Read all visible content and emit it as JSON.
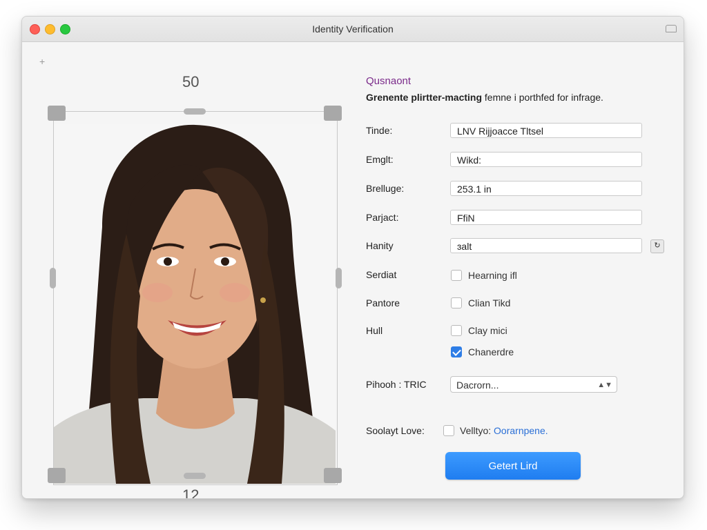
{
  "window": {
    "title": "Identity Verification"
  },
  "crop": {
    "top_value": "50",
    "bottom_value": "12",
    "add_icon": "+"
  },
  "form": {
    "heading": "Qusnaont",
    "subtitle_bold": "Grenente plirtter-macting",
    "subtitle_rest": " femne i porthfed for infrage.",
    "fields": [
      {
        "label": "Tinde:",
        "value": "LNV Rijjoacce Tltsel"
      },
      {
        "label": "Emglt:",
        "value": "Wikd:"
      },
      {
        "label": "Brelluge:",
        "value": "253.1 in"
      },
      {
        "label": "Parjact:",
        "value": "FfiN"
      },
      {
        "label": "Hanity",
        "value": "ɜalt",
        "button_icon": "refresh-icon"
      }
    ],
    "checkbox_rows": [
      {
        "label": "Serdiat",
        "option": "Hearning ifl",
        "checked": false
      },
      {
        "label": "Pantore",
        "option": "Clian Tikd",
        "checked": false
      },
      {
        "label": "Hull",
        "option": "Clay mici",
        "checked": false
      },
      {
        "label": "",
        "option": "Chanerdre",
        "checked": true
      }
    ],
    "select_label": "Pihooh : TRIC",
    "select_value": "Dacrorn...",
    "bottom_label": "Soolayt Love:",
    "bottom_checkbox_text": "Velltyo:",
    "bottom_link": "Oorarnpene.",
    "submit_label": "Getert Lird"
  },
  "colors": {
    "accent": "#1f7df0",
    "heading": "#7a2a8a",
    "link": "#2a6fd6"
  }
}
